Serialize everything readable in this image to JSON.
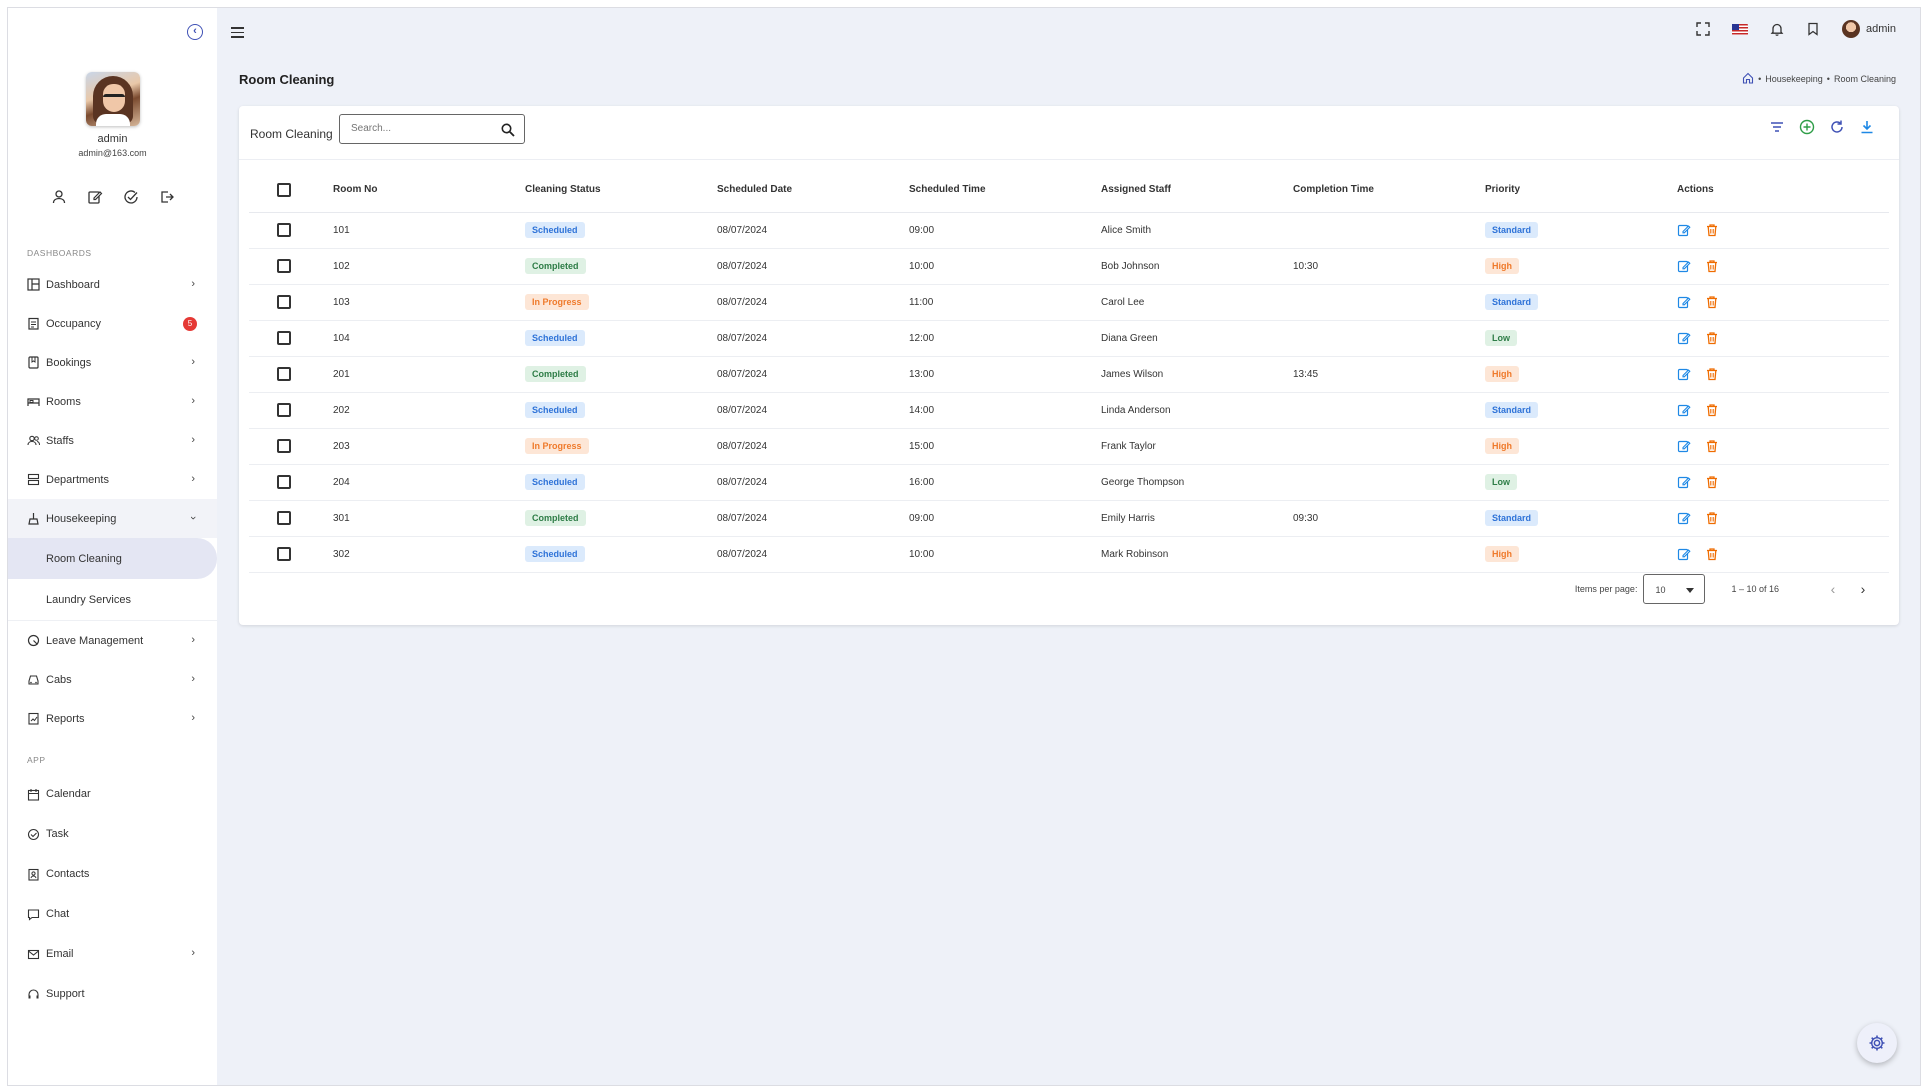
{
  "sidebar": {
    "profile": {
      "name": "admin",
      "email": "admin@163.com"
    },
    "section_dashboards": "DASHBOARDS",
    "section_app": "APP",
    "items": [
      {
        "label": "Dashboard"
      },
      {
        "label": "Occupancy",
        "badge": "5"
      },
      {
        "label": "Bookings"
      },
      {
        "label": "Rooms"
      },
      {
        "label": "Staffs"
      },
      {
        "label": "Departments"
      },
      {
        "label": "Housekeeping",
        "sub": [
          "Room Cleaning",
          "Laundry Services"
        ]
      },
      {
        "label": "Leave Management"
      },
      {
        "label": "Cabs"
      },
      {
        "label": "Reports"
      }
    ],
    "app_items": [
      {
        "label": "Calendar"
      },
      {
        "label": "Task"
      },
      {
        "label": "Contacts"
      },
      {
        "label": "Chat"
      },
      {
        "label": "Email"
      },
      {
        "label": "Support"
      }
    ]
  },
  "topbar": {
    "user": "admin"
  },
  "page": {
    "title": "Room Cleaning",
    "breadcrumb": [
      "Housekeeping",
      "Room Cleaning"
    ]
  },
  "card": {
    "title": "Room Cleaning",
    "search_placeholder": "Search..."
  },
  "table": {
    "headers": [
      "Room No",
      "Cleaning Status",
      "Scheduled Date",
      "Scheduled Time",
      "Assigned Staff",
      "Completion Time",
      "Priority",
      "Actions"
    ],
    "rows": [
      {
        "room": "101",
        "status": "Scheduled",
        "date": "08/07/2024",
        "time": "09:00",
        "staff": "Alice Smith",
        "completion": "",
        "priority": "Standard"
      },
      {
        "room": "102",
        "status": "Completed",
        "date": "08/07/2024",
        "time": "10:00",
        "staff": "Bob Johnson",
        "completion": "10:30",
        "priority": "High"
      },
      {
        "room": "103",
        "status": "In Progress",
        "date": "08/07/2024",
        "time": "11:00",
        "staff": "Carol Lee",
        "completion": "",
        "priority": "Standard"
      },
      {
        "room": "104",
        "status": "Scheduled",
        "date": "08/07/2024",
        "time": "12:00",
        "staff": "Diana Green",
        "completion": "",
        "priority": "Low"
      },
      {
        "room": "201",
        "status": "Completed",
        "date": "08/07/2024",
        "time": "13:00",
        "staff": "James Wilson",
        "completion": "13:45",
        "priority": "High"
      },
      {
        "room": "202",
        "status": "Scheduled",
        "date": "08/07/2024",
        "time": "14:00",
        "staff": "Linda Anderson",
        "completion": "",
        "priority": "Standard"
      },
      {
        "room": "203",
        "status": "In Progress",
        "date": "08/07/2024",
        "time": "15:00",
        "staff": "Frank Taylor",
        "completion": "",
        "priority": "High"
      },
      {
        "room": "204",
        "status": "Scheduled",
        "date": "08/07/2024",
        "time": "16:00",
        "staff": "George Thompson",
        "completion": "",
        "priority": "Low"
      },
      {
        "room": "301",
        "status": "Completed",
        "date": "08/07/2024",
        "time": "09:00",
        "staff": "Emily Harris",
        "completion": "09:30",
        "priority": "Standard"
      },
      {
        "room": "302",
        "status": "Scheduled",
        "date": "08/07/2024",
        "time": "10:00",
        "staff": "Mark Robinson",
        "completion": "",
        "priority": "High"
      }
    ]
  },
  "pager": {
    "items_per_page_label": "Items per page:",
    "items_per_page": "10",
    "range": "1 – 10 of 16"
  },
  "colors": {
    "accent": "#3f51b5",
    "scheduled": "#2f73d8",
    "completed": "#2e7d47",
    "in_progress": "#ef7a2b",
    "delete": "#ef6c00",
    "edit": "#1e88e5"
  }
}
